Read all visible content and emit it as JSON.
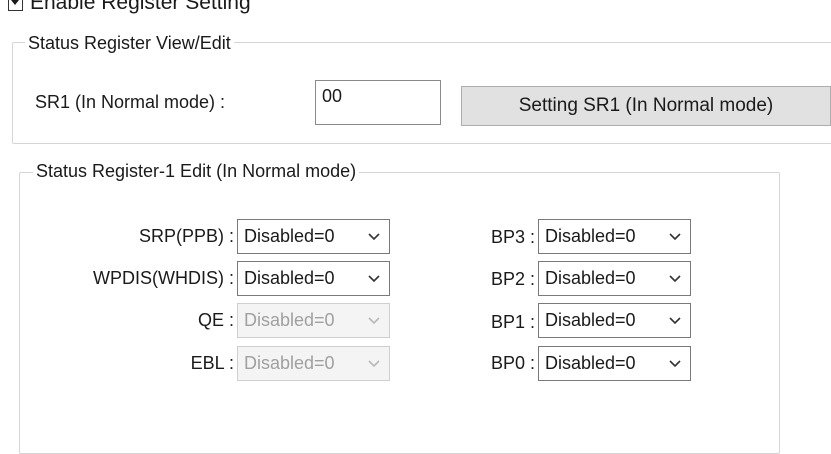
{
  "enable_checkbox": {
    "label": "Enable Register Setting"
  },
  "status_group": {
    "legend": "Status Register View/Edit",
    "sr1_label": "SR1 (In Normal mode) :",
    "sr1_value": "00",
    "setting_button": "Setting SR1 (In Normal mode)"
  },
  "edit_group": {
    "legend": "Status Register-1 Edit  (In Normal mode)",
    "left_fields": [
      {
        "label": "SRP(PPB) :",
        "value": "Disabled=0",
        "enabled": true
      },
      {
        "label": "WPDIS(WHDIS) :",
        "value": "Disabled=0",
        "enabled": true
      },
      {
        "label": "QE :",
        "value": "Disabled=0",
        "enabled": false
      },
      {
        "label": "EBL :",
        "value": "Disabled=0",
        "enabled": false
      }
    ],
    "right_fields": [
      {
        "label": "BP3 :",
        "value": "Disabled=0",
        "enabled": true
      },
      {
        "label": "BP2 :",
        "value": "Disabled=0",
        "enabled": true
      },
      {
        "label": "BP1 :",
        "value": "Disabled=0",
        "enabled": true
      },
      {
        "label": "BP0 :",
        "value": "Disabled=0",
        "enabled": true
      }
    ]
  },
  "colors": {
    "border": "#d5d5d5",
    "button_bg": "#e1e1e1",
    "disabled_text": "#a0a0a0"
  },
  "icons": {
    "dropdown": "chevron-down-icon"
  }
}
